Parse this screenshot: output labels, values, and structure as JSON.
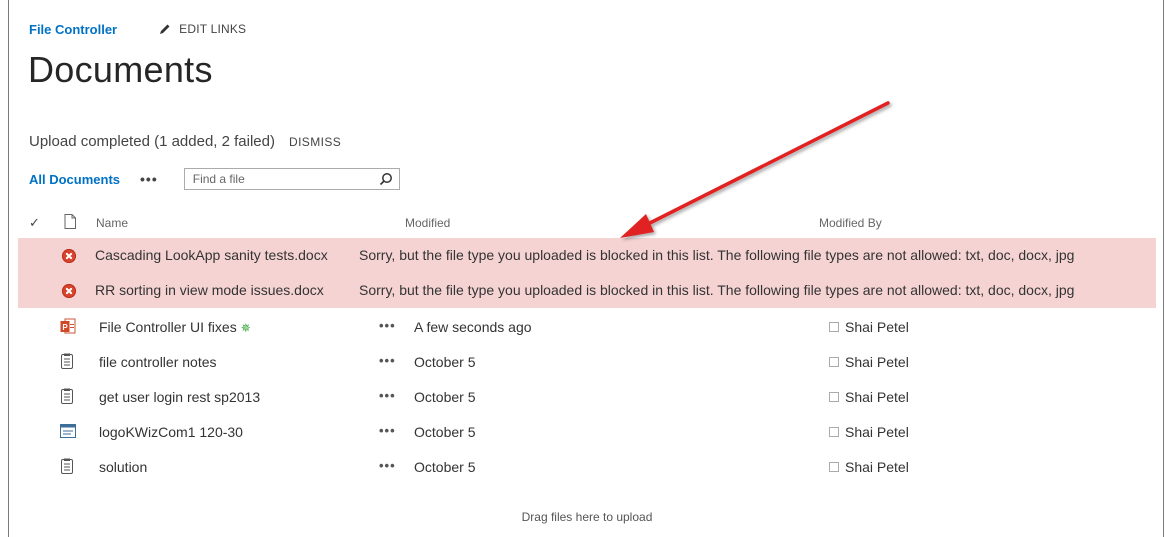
{
  "nav": {
    "site": "File Controller",
    "edit_links": "EDIT LINKS"
  },
  "page": {
    "title": "Documents"
  },
  "status": {
    "message": "Upload completed (1 added, 2 failed)",
    "dismiss": "DISMISS"
  },
  "view": {
    "name": "All Documents",
    "more": "•••",
    "search_placeholder": "Find a file"
  },
  "columns": {
    "check": "✓",
    "name": "Name",
    "modified": "Modified",
    "modified_by": "Modified By"
  },
  "errors": [
    {
      "name": "Cascading LookApp sanity tests.docx",
      "message": "Sorry, but the file type you uploaded is blocked in this list. The following file types are not allowed: txt, doc, docx, jpg"
    },
    {
      "name": "RR sorting in view mode issues.docx",
      "message": "Sorry, but the file type you uploaded is blocked in this list. The following file types are not allowed: txt, doc, docx, jpg"
    }
  ],
  "files": [
    {
      "name": "File Controller UI fixes",
      "icon": "powerpoint-icon",
      "new_marker": "✵",
      "dots": "•••",
      "modified": "A few seconds ago",
      "modified_by": "Shai Petel"
    },
    {
      "name": "file controller notes",
      "icon": "text-file-icon",
      "dots": "•••",
      "modified": "October 5",
      "modified_by": "Shai Petel"
    },
    {
      "name": "get user login rest sp2013",
      "icon": "text-file-icon",
      "dots": "•••",
      "modified": "October 5",
      "modified_by": "Shai Petel"
    },
    {
      "name": "logoKWizCom1 120-30",
      "icon": "image-file-icon",
      "dots": "•••",
      "modified": "October 5",
      "modified_by": "Shai Petel"
    },
    {
      "name": "solution",
      "icon": "text-file-icon",
      "dots": "•••",
      "modified": "October 5",
      "modified_by": "Shai Petel"
    }
  ],
  "drop_zone": "Drag files here to upload",
  "colors": {
    "link": "#0072c6",
    "error_row": "#f6d3d3",
    "arrow": "#e02020"
  }
}
